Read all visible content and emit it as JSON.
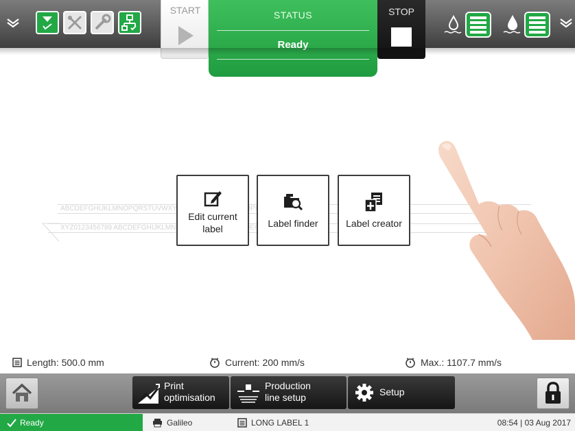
{
  "header": {
    "start_label": "START",
    "status_title": "STATUS",
    "status_value": "Ready",
    "stop_label": "STOP",
    "status_icons": [
      "printhead-status-icon",
      "jet-status-icon",
      "service-status-icon",
      "network-status-icon"
    ],
    "colors": {
      "accent_green": "#22a845",
      "bar_gray": "#5a5a5a"
    }
  },
  "background_label": {
    "line1": "ABCDEFGHIJKLMNOPQRSTUVWXYZ ABCDEFGHIJKLMNOPQRSTUVWXYZ",
    "line2": "XYZ0123456789 ABCDEFGHIJKLMN XYZ0123456789 ABCDEFGHIJKL"
  },
  "tiles": [
    {
      "label": "Edit current label",
      "icon": "edit-icon"
    },
    {
      "label": "Label finder",
      "icon": "folder-search-icon"
    },
    {
      "label": "Label creator",
      "icon": "label-add-icon"
    }
  ],
  "info": {
    "length": "Length: 500.0 mm",
    "current": "Current: 200 mm/s",
    "max": "Max.: 1107.7 mm/s"
  },
  "nav": {
    "print_opt_line1": "Print",
    "print_opt_line2": "optimisation",
    "production_line1": "Production",
    "production_line2": "line setup",
    "setup": "Setup"
  },
  "statusbar": {
    "ready": "Ready",
    "printer": "Galileo",
    "label": "LONG LABEL 1",
    "datetime": "08:54 | 03 Aug 2017"
  }
}
